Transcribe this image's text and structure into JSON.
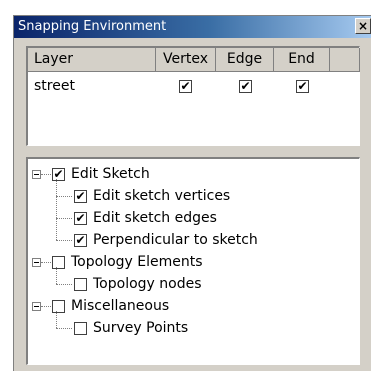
{
  "window": {
    "title": "Snapping Environment",
    "close_label": "×"
  },
  "layer_table": {
    "columns": [
      "Layer",
      "Vertex",
      "Edge",
      "End"
    ],
    "rows": [
      {
        "layer": "street",
        "vertex": true,
        "edge": true,
        "end": true
      }
    ],
    "check_glyph": "✔"
  },
  "tree": {
    "items": [
      {
        "label": "Edit Sketch",
        "checked": true,
        "level": 0
      },
      {
        "label": "Edit sketch vertices",
        "checked": true,
        "level": 1
      },
      {
        "label": "Edit sketch edges",
        "checked": true,
        "level": 1
      },
      {
        "label": "Perpendicular to sketch",
        "checked": true,
        "level": 1
      },
      {
        "label": "Topology Elements",
        "checked": false,
        "level": 0
      },
      {
        "label": "Topology nodes",
        "checked": false,
        "level": 1
      },
      {
        "label": "Miscellaneous",
        "checked": false,
        "level": 0
      },
      {
        "label": "Survey Points",
        "checked": false,
        "level": 1
      }
    ]
  }
}
